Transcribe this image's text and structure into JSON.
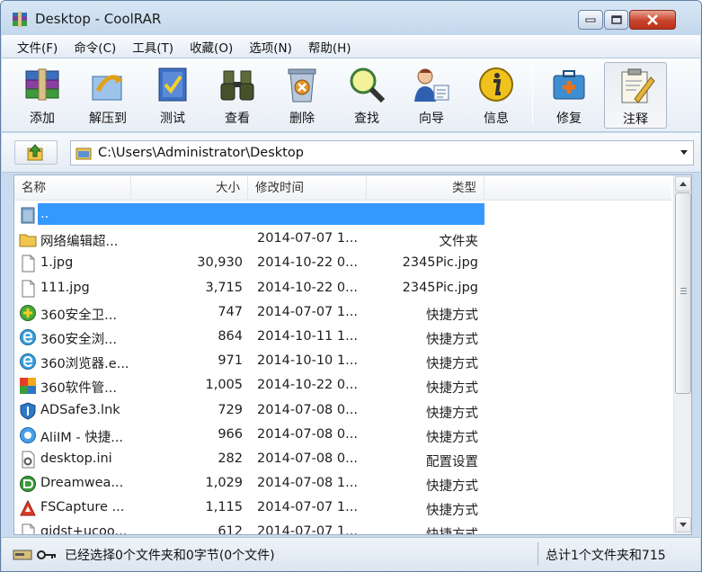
{
  "window": {
    "title": "Desktop - CoolRAR"
  },
  "menu": [
    "文件(F)",
    "命令(C)",
    "工具(T)",
    "收藏(O)",
    "选项(N)",
    "帮助(H)"
  ],
  "toolbar": {
    "add": "添加",
    "extract": "解压到",
    "test": "测试",
    "view": "查看",
    "delete": "删除",
    "find": "查找",
    "wizard": "向导",
    "info": "信息",
    "repair": "修复",
    "comment": "注释"
  },
  "address": {
    "path": "C:\\Users\\Administrator\\Desktop"
  },
  "columns": {
    "name": "名称",
    "size": "大小",
    "modified": "修改时间",
    "type": "类型"
  },
  "files": [
    {
      "name": "..",
      "size": "",
      "modified": "",
      "type": "",
      "icon": "parent-folder-icon"
    },
    {
      "name": "网络编辑超...",
      "size": "",
      "modified": "2014-07-07 1...",
      "type": "文件夹",
      "icon": "folder-icon"
    },
    {
      "name": "1.jpg",
      "size": "30,930",
      "modified": "2014-10-22 0...",
      "type": "2345Pic.jpg",
      "icon": "file-icon"
    },
    {
      "name": "111.jpg",
      "size": "3,715",
      "modified": "2014-10-22 0...",
      "type": "2345Pic.jpg",
      "icon": "file-icon"
    },
    {
      "name": "360安全卫...",
      "size": "747",
      "modified": "2014-07-07 1...",
      "type": "快捷方式",
      "icon": "360-safe-icon"
    },
    {
      "name": "360安全浏...",
      "size": "864",
      "modified": "2014-10-11 1...",
      "type": "快捷方式",
      "icon": "browser-e-icon"
    },
    {
      "name": "360浏览器.e...",
      "size": "971",
      "modified": "2014-10-10 1...",
      "type": "快捷方式",
      "icon": "browser-e-icon"
    },
    {
      "name": "360软件管...",
      "size": "1,005",
      "modified": "2014-10-22 0...",
      "type": "快捷方式",
      "icon": "software-manager-icon"
    },
    {
      "name": "ADSafe3.lnk",
      "size": "729",
      "modified": "2014-07-08 0...",
      "type": "快捷方式",
      "icon": "shield-icon"
    },
    {
      "name": "AliIM - 快捷...",
      "size": "966",
      "modified": "2014-07-08 0...",
      "type": "快捷方式",
      "icon": "aliim-icon"
    },
    {
      "name": "desktop.ini",
      "size": "282",
      "modified": "2014-07-08 0...",
      "type": "配置设置",
      "icon": "settings-file-icon"
    },
    {
      "name": "Dreamwea...",
      "size": "1,029",
      "modified": "2014-07-08 1...",
      "type": "快捷方式",
      "icon": "dreamweaver-icon"
    },
    {
      "name": "FSCapture ...",
      "size": "1,115",
      "modified": "2014-07-07 1...",
      "type": "快捷方式",
      "icon": "fscapture-icon"
    },
    {
      "name": "gidst+ucoo...",
      "size": "612",
      "modified": "2014-07-07 1...",
      "type": "快捷方式",
      "icon": "file-icon"
    }
  ],
  "status": {
    "left": "已经选择0个文件夹和0字节(0个文件)",
    "right": "总计1个文件夹和715"
  }
}
